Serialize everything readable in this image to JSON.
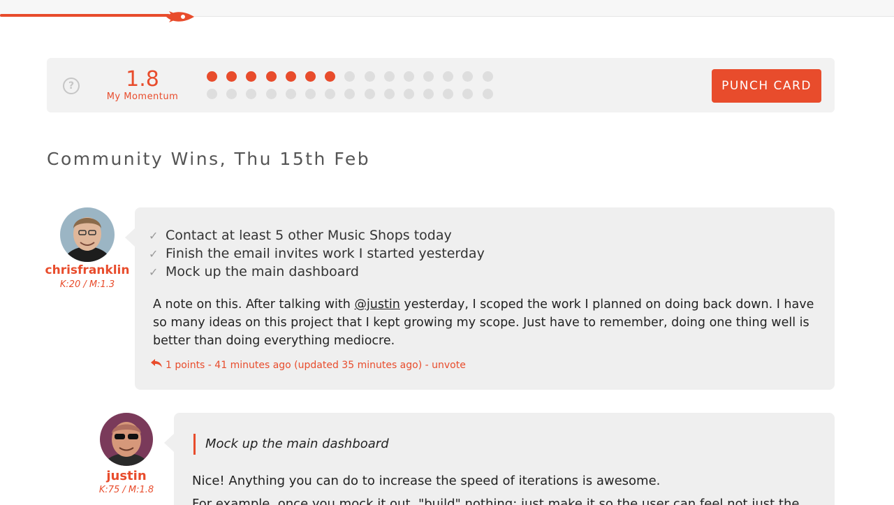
{
  "colors": {
    "accent": "#e84c2c",
    "panel": "#f2f2f2",
    "bubble": "#efefef",
    "dot_off": "#dedede"
  },
  "topbar": {
    "progress_fraction": 0.19,
    "icon": "rocket-icon"
  },
  "momentum": {
    "help_icon": "question-circle-icon",
    "help_glyph": "?",
    "value": "1.8",
    "label": "My Momentum",
    "dots_filled": 7,
    "dots_per_row": 15,
    "dot_rows": 2,
    "punch_card_label": "PUNCH CARD"
  },
  "section": {
    "title": "Community Wins, Thu 15th Feb"
  },
  "posts": [
    {
      "author": "chrisfranklin",
      "stats": "K:20 / M:1.3",
      "check_glyph": "✓",
      "checklist": [
        "Contact at least 5 other Music Shops today",
        "Finish the email invites work I started yesterday",
        "Mock up the main dashboard"
      ],
      "note_before": "A note on this. After talking with ",
      "mention": "@justin",
      "note_after": " yesterday, I scoped the work I planned on doing back down. I have so many ideas on this project that I kept growing my scope. Just have to remember, doing one thing well is better than doing everything mediocre.",
      "meta": "1 points - 41 minutes ago (updated 35 minutes ago) - unvote",
      "reply_icon": "reply-icon"
    },
    {
      "author": "justin",
      "stats": "K:75 / M:1.8",
      "quote": "Mock up the main dashboard",
      "text": "Nice! Anything you can do to increase the speed of iterations is awesome.",
      "text_cut": "For example, once you mock it out, \"build\" nothing: just make it so the user can feel not just the..."
    }
  ]
}
